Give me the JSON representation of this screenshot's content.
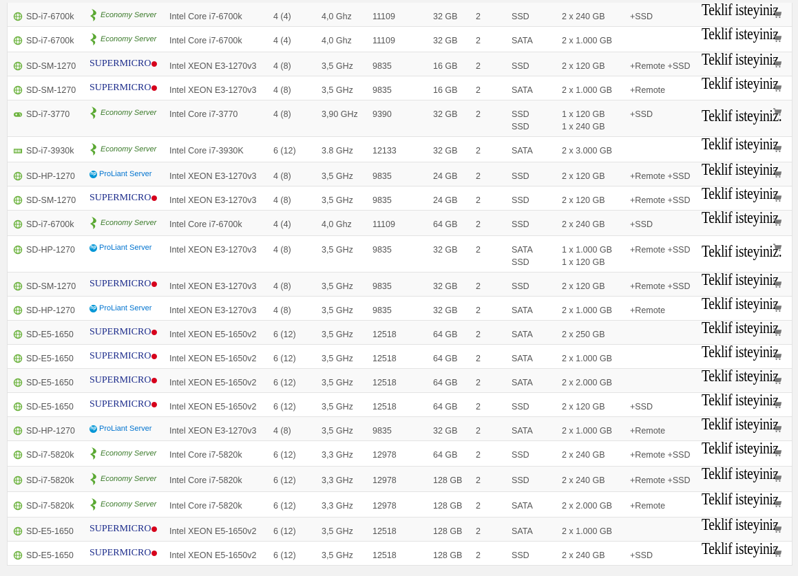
{
  "colors": {
    "globe_icon": "#6db33f",
    "economy_green": "#3b7a2a",
    "supermicro_blue": "#1a2a8a",
    "supermicro_red": "#d6001c",
    "hp_blue": "#0096d6"
  },
  "rows": [
    {
      "icon": "globe-icon",
      "name": "SD-i7-6700k",
      "brand": "economy",
      "brand_label": "Economy Server",
      "cpu": "Intel Core i7-6700k",
      "cores": "4 (4)",
      "ghz": "4,0 Ghz",
      "score": "11109",
      "ram": "32 GB",
      "ip": "2",
      "disk": [
        "SSD"
      ],
      "cap": [
        "2 x 240 GB"
      ],
      "extra": "+SSD",
      "quote": "Teklif isteyiniz."
    },
    {
      "icon": "globe-icon",
      "name": "SD-i7-6700k",
      "brand": "economy",
      "brand_label": "Economy Server",
      "cpu": "Intel Core i7-6700k",
      "cores": "4 (4)",
      "ghz": "4,0 Ghz",
      "score": "11109",
      "ram": "32 GB",
      "ip": "2",
      "disk": [
        "SATA"
      ],
      "cap": [
        "2 x 1.000 GB"
      ],
      "extra": "",
      "quote": "Teklif isteyiniz."
    },
    {
      "icon": "globe-icon",
      "name": "SD-SM-1270",
      "brand": "supermicro",
      "brand_label": "SUPERMICRO",
      "cpu": "Intel XEON E3-1270v3",
      "cores": "4 (8)",
      "ghz": "3,5 GHz",
      "score": "9835",
      "ram": "16 GB",
      "ip": "2",
      "disk": [
        "SSD"
      ],
      "cap": [
        "2 x 120 GB"
      ],
      "extra": "+Remote +SSD",
      "quote": "Teklif isteyiniz."
    },
    {
      "icon": "globe-icon",
      "name": "SD-SM-1270",
      "brand": "supermicro",
      "brand_label": "SUPERMICRO",
      "cpu": "Intel XEON E3-1270v3",
      "cores": "4 (8)",
      "ghz": "3,5 GHz",
      "score": "9835",
      "ram": "16 GB",
      "ip": "2",
      "disk": [
        "SATA"
      ],
      "cap": [
        "2 x 1.000 GB"
      ],
      "extra": "+Remote",
      "quote": "Teklif isteyiniz."
    },
    {
      "icon": "gamepad-icon",
      "name": "SD-i7-3770",
      "brand": "economy",
      "brand_label": "Economy Server",
      "cpu": "Intel Core i7-3770",
      "cores": "4 (8)",
      "ghz": "3,90 GHz",
      "score": "9390",
      "ram": "32 GB",
      "ip": "2",
      "disk": [
        "SSD",
        "SSD"
      ],
      "cap": [
        "1 x 120 GB",
        "1 x 240 GB"
      ],
      "extra": "+SSD",
      "quote": "Teklif isteyiniz."
    },
    {
      "icon": "server-icon",
      "name": "SD-i7-3930k",
      "brand": "economy",
      "brand_label": "Economy Server",
      "cpu": "Intel Core i7-3930K",
      "cores": "6 (12)",
      "ghz": "3.8 GHz",
      "score": "12133",
      "ram": "32 GB",
      "ip": "2",
      "disk": [
        "SATA"
      ],
      "cap": [
        "2 x 3.000 GB"
      ],
      "extra": "",
      "quote": "Teklif isteyiniz."
    },
    {
      "icon": "globe-icon",
      "name": "SD-HP-1270",
      "brand": "hp",
      "brand_label": "ProLiant Server",
      "cpu": "Intel XEON E3-1270v3",
      "cores": "4 (8)",
      "ghz": "3,5 GHz",
      "score": "9835",
      "ram": "24 GB",
      "ip": "2",
      "disk": [
        "SSD"
      ],
      "cap": [
        "2 x 120 GB"
      ],
      "extra": "+Remote +SSD",
      "quote": "Teklif isteyiniz."
    },
    {
      "icon": "globe-icon",
      "name": "SD-SM-1270",
      "brand": "supermicro",
      "brand_label": "SUPERMICRO",
      "cpu": "Intel XEON E3-1270v3",
      "cores": "4 (8)",
      "ghz": "3,5 GHz",
      "score": "9835",
      "ram": "24 GB",
      "ip": "2",
      "disk": [
        "SSD"
      ],
      "cap": [
        "2 x 120 GB"
      ],
      "extra": "+Remote +SSD",
      "quote": "Teklif isteyiniz."
    },
    {
      "icon": "globe-icon",
      "name": "SD-i7-6700k",
      "brand": "economy",
      "brand_label": "Economy Server",
      "cpu": "Intel Core i7-6700k",
      "cores": "4 (4)",
      "ghz": "4,0 Ghz",
      "score": "11109",
      "ram": "64 GB",
      "ip": "2",
      "disk": [
        "SSD"
      ],
      "cap": [
        "2 x 240 GB"
      ],
      "extra": "+SSD",
      "quote": "Teklif isteyiniz."
    },
    {
      "icon": "globe-icon",
      "name": "SD-HP-1270",
      "brand": "hp",
      "brand_label": "ProLiant Server",
      "cpu": "Intel XEON E3-1270v3",
      "cores": "4 (8)",
      "ghz": "3,5 GHz",
      "score": "9835",
      "ram": "32 GB",
      "ip": "2",
      "disk": [
        "SATA",
        "SSD"
      ],
      "cap": [
        "1 x 1.000 GB",
        "1 x 120 GB"
      ],
      "extra": "+Remote +SSD",
      "quote": "Teklif isteyiniz."
    },
    {
      "icon": "globe-icon",
      "name": "SD-SM-1270",
      "brand": "supermicro",
      "brand_label": "SUPERMICRO",
      "cpu": "Intel XEON E3-1270v3",
      "cores": "4 (8)",
      "ghz": "3,5 GHz",
      "score": "9835",
      "ram": "32 GB",
      "ip": "2",
      "disk": [
        "SSD"
      ],
      "cap": [
        "2 x 120 GB"
      ],
      "extra": "+Remote +SSD",
      "quote": "Teklif isteyiniz."
    },
    {
      "icon": "globe-icon",
      "name": "SD-HP-1270",
      "brand": "hp",
      "brand_label": "ProLiant Server",
      "cpu": "Intel XEON E3-1270v3",
      "cores": "4 (8)",
      "ghz": "3,5 GHz",
      "score": "9835",
      "ram": "32 GB",
      "ip": "2",
      "disk": [
        "SATA"
      ],
      "cap": [
        "2 x 1.000 GB"
      ],
      "extra": "+Remote",
      "quote": "Teklif isteyiniz."
    },
    {
      "icon": "globe-icon",
      "name": "SD-E5-1650",
      "brand": "supermicro",
      "brand_label": "SUPERMICRO",
      "cpu": "Intel XEON E5-1650v2",
      "cores": "6 (12)",
      "ghz": "3,5 GHz",
      "score": "12518",
      "ram": "64 GB",
      "ip": "2",
      "disk": [
        "SATA"
      ],
      "cap": [
        "2 x 250 GB"
      ],
      "extra": "",
      "quote": "Teklif isteyiniz."
    },
    {
      "icon": "globe-icon",
      "name": "SD-E5-1650",
      "brand": "supermicro",
      "brand_label": "SUPERMICRO",
      "cpu": "Intel XEON E5-1650v2",
      "cores": "6 (12)",
      "ghz": "3,5 GHz",
      "score": "12518",
      "ram": "64 GB",
      "ip": "2",
      "disk": [
        "SATA"
      ],
      "cap": [
        "2 x 1.000 GB"
      ],
      "extra": "",
      "quote": "Teklif isteyiniz."
    },
    {
      "icon": "globe-icon",
      "name": "SD-E5-1650",
      "brand": "supermicro",
      "brand_label": "SUPERMICRO",
      "cpu": "Intel XEON E5-1650v2",
      "cores": "6 (12)",
      "ghz": "3,5 GHz",
      "score": "12518",
      "ram": "64 GB",
      "ip": "2",
      "disk": [
        "SATA"
      ],
      "cap": [
        "2 x 2.000 GB"
      ],
      "extra": "",
      "quote": "Teklif isteyiniz."
    },
    {
      "icon": "globe-icon",
      "name": "SD-E5-1650",
      "brand": "supermicro",
      "brand_label": "SUPERMICRO",
      "cpu": "Intel XEON E5-1650v2",
      "cores": "6 (12)",
      "ghz": "3,5 GHz",
      "score": "12518",
      "ram": "64 GB",
      "ip": "2",
      "disk": [
        "SSD"
      ],
      "cap": [
        "2 x 120 GB"
      ],
      "extra": "+SSD",
      "quote": "Teklif isteyiniz."
    },
    {
      "icon": "globe-icon",
      "name": "SD-HP-1270",
      "brand": "hp",
      "brand_label": "ProLiant Server",
      "cpu": "Intel XEON E3-1270v3",
      "cores": "4 (8)",
      "ghz": "3,5 GHz",
      "score": "9835",
      "ram": "32 GB",
      "ip": "2",
      "disk": [
        "SATA"
      ],
      "cap": [
        "2 x 1.000 GB"
      ],
      "extra": "+Remote",
      "quote": "Teklif isteyiniz."
    },
    {
      "icon": "globe-icon",
      "name": "SD-i7-5820k",
      "brand": "economy",
      "brand_label": "Economy Server",
      "cpu": "Intel Core i7-5820k",
      "cores": "6 (12)",
      "ghz": "3,3 GHz",
      "score": "12978",
      "ram": "64 GB",
      "ip": "2",
      "disk": [
        "SSD"
      ],
      "cap": [
        "2 x 240 GB"
      ],
      "extra": "+Remote +SSD",
      "quote": "Teklif isteyiniz."
    },
    {
      "icon": "globe-icon",
      "name": "SD-i7-5820k",
      "brand": "economy",
      "brand_label": "Economy Server",
      "cpu": "Intel Core i7-5820k",
      "cores": "6 (12)",
      "ghz": "3,3 GHz",
      "score": "12978",
      "ram": "128 GB",
      "ip": "2",
      "disk": [
        "SSD"
      ],
      "cap": [
        "2 x 240 GB"
      ],
      "extra": "+Remote +SSD",
      "quote": "Teklif isteyiniz."
    },
    {
      "icon": "globe-icon",
      "name": "SD-i7-5820k",
      "brand": "economy",
      "brand_label": "Economy Server",
      "cpu": "Intel Core i7-5820k",
      "cores": "6 (12)",
      "ghz": "3,3 GHz",
      "score": "12978",
      "ram": "128 GB",
      "ip": "2",
      "disk": [
        "SATA"
      ],
      "cap": [
        "2 x 2.000 GB"
      ],
      "extra": "+Remote",
      "quote": "Teklif isteyiniz."
    },
    {
      "icon": "globe-icon",
      "name": "SD-E5-1650",
      "brand": "supermicro",
      "brand_label": "SUPERMICRO",
      "cpu": "Intel XEON E5-1650v2",
      "cores": "6 (12)",
      "ghz": "3,5 GHz",
      "score": "12518",
      "ram": "128 GB",
      "ip": "2",
      "disk": [
        "SATA"
      ],
      "cap": [
        "2 x 1.000 GB"
      ],
      "extra": "",
      "quote": "Teklif isteyiniz."
    },
    {
      "icon": "globe-icon",
      "name": "SD-E5-1650",
      "brand": "supermicro",
      "brand_label": "SUPERMICRO",
      "cpu": "Intel XEON E5-1650v2",
      "cores": "6 (12)",
      "ghz": "3,5 GHz",
      "score": "12518",
      "ram": "128 GB",
      "ip": "2",
      "disk": [
        "SSD"
      ],
      "cap": [
        "2 x 240 GB"
      ],
      "extra": "+SSD",
      "quote": "Teklif isteyiniz."
    }
  ]
}
